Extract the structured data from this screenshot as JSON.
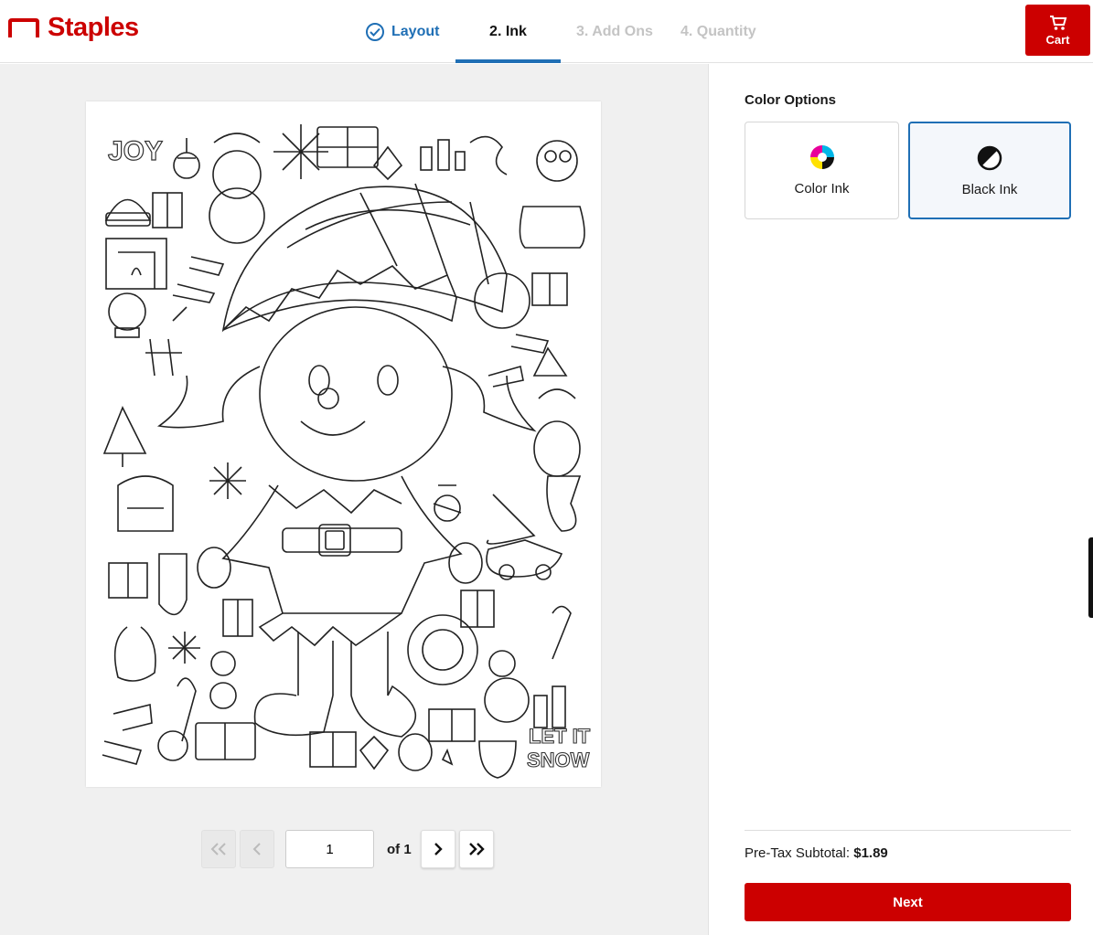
{
  "brand": {
    "name": "Staples",
    "color": "#cc0000"
  },
  "steps": [
    {
      "label": "Layout",
      "state": "done",
      "icon": "check-icon"
    },
    {
      "label": "2. Ink",
      "state": "active"
    },
    {
      "label": "3. Add Ons",
      "state": "disabled"
    },
    {
      "label": "4. Quantity",
      "state": "disabled"
    }
  ],
  "cart": {
    "label": "Cart",
    "icon": "cart-icon"
  },
  "preview": {
    "page_title_art": [
      "JOY",
      "LET IT",
      "SNOW"
    ]
  },
  "pager": {
    "current": "1",
    "of_label": "of 1"
  },
  "panel": {
    "title": "Color Options",
    "options": [
      {
        "label": "Color Ink",
        "icon": "cmyk-icon",
        "selected": false
      },
      {
        "label": "Black Ink",
        "icon": "black-ink-icon",
        "selected": true
      }
    ],
    "subtotal_label": "Pre-Tax Subtotal:",
    "subtotal_value": "$1.89",
    "next_label": "Next"
  },
  "colors": {
    "accent": "#1f6fb5",
    "primary": "#cc0000"
  }
}
